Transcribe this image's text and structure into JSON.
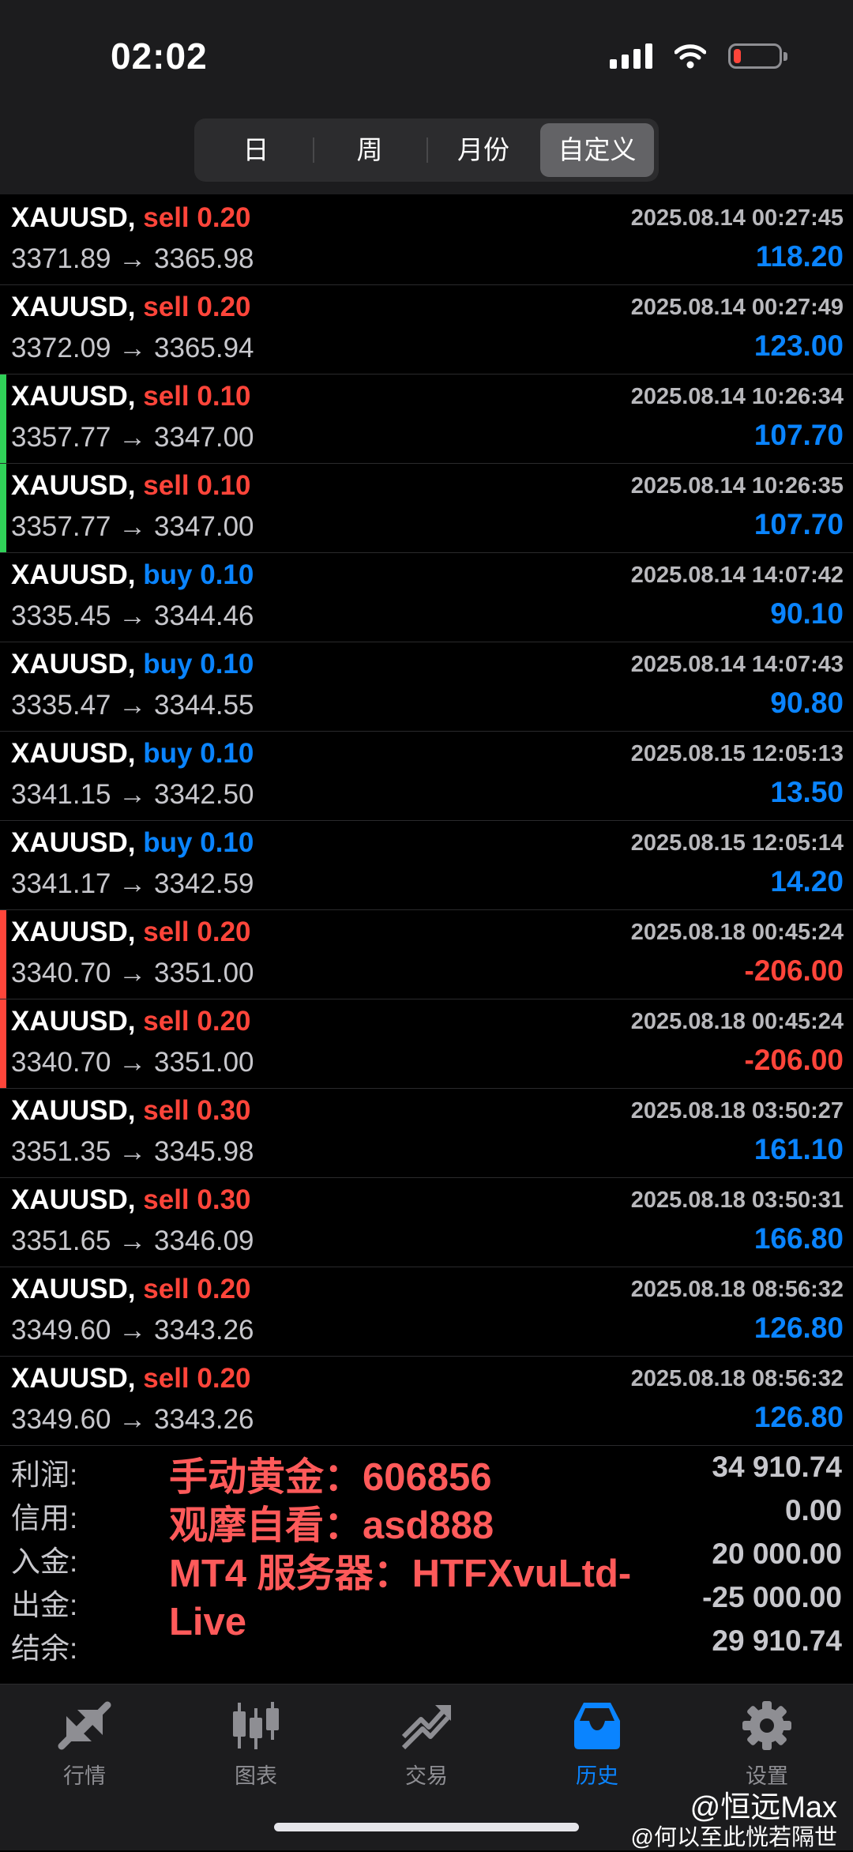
{
  "status_bar": {
    "time": "02:02"
  },
  "period_tabs": [
    {
      "label": "日",
      "active": false
    },
    {
      "label": "周",
      "active": false
    },
    {
      "label": "月份",
      "active": false
    },
    {
      "label": "自定义",
      "active": true
    }
  ],
  "colors": {
    "sell": "#ff453a",
    "buy": "#0a84ff",
    "profit": "#0a84ff",
    "loss": "#ff453a",
    "marker_green": "#30d158",
    "marker_red": "#ff453a"
  },
  "trades": [
    {
      "symbol": "XAUUSD,",
      "side": "sell",
      "lots": "0.20",
      "time": "2025.08.14 00:27:45",
      "open": "3371.89",
      "close": "3365.98",
      "profit": "118.20",
      "marker": ""
    },
    {
      "symbol": "XAUUSD,",
      "side": "sell",
      "lots": "0.20",
      "time": "2025.08.14 00:27:49",
      "open": "3372.09",
      "close": "3365.94",
      "profit": "123.00",
      "marker": ""
    },
    {
      "symbol": "XAUUSD,",
      "side": "sell",
      "lots": "0.10",
      "time": "2025.08.14 10:26:34",
      "open": "3357.77",
      "close": "3347.00",
      "profit": "107.70",
      "marker": "green"
    },
    {
      "symbol": "XAUUSD,",
      "side": "sell",
      "lots": "0.10",
      "time": "2025.08.14 10:26:35",
      "open": "3357.77",
      "close": "3347.00",
      "profit": "107.70",
      "marker": "green"
    },
    {
      "symbol": "XAUUSD,",
      "side": "buy",
      "lots": "0.10",
      "time": "2025.08.14 14:07:42",
      "open": "3335.45",
      "close": "3344.46",
      "profit": "90.10",
      "marker": ""
    },
    {
      "symbol": "XAUUSD,",
      "side": "buy",
      "lots": "0.10",
      "time": "2025.08.14 14:07:43",
      "open": "3335.47",
      "close": "3344.55",
      "profit": "90.80",
      "marker": ""
    },
    {
      "symbol": "XAUUSD,",
      "side": "buy",
      "lots": "0.10",
      "time": "2025.08.15 12:05:13",
      "open": "3341.15",
      "close": "3342.50",
      "profit": "13.50",
      "marker": ""
    },
    {
      "symbol": "XAUUSD,",
      "side": "buy",
      "lots": "0.10",
      "time": "2025.08.15 12:05:14",
      "open": "3341.17",
      "close": "3342.59",
      "profit": "14.20",
      "marker": ""
    },
    {
      "symbol": "XAUUSD,",
      "side": "sell",
      "lots": "0.20",
      "time": "2025.08.18 00:45:24",
      "open": "3340.70",
      "close": "3351.00",
      "profit": "-206.00",
      "marker": "red"
    },
    {
      "symbol": "XAUUSD,",
      "side": "sell",
      "lots": "0.20",
      "time": "2025.08.18 00:45:24",
      "open": "3340.70",
      "close": "3351.00",
      "profit": "-206.00",
      "marker": "red"
    },
    {
      "symbol": "XAUUSD,",
      "side": "sell",
      "lots": "0.30",
      "time": "2025.08.18 03:50:27",
      "open": "3351.35",
      "close": "3345.98",
      "profit": "161.10",
      "marker": ""
    },
    {
      "symbol": "XAUUSD,",
      "side": "sell",
      "lots": "0.30",
      "time": "2025.08.18 03:50:31",
      "open": "3351.65",
      "close": "3346.09",
      "profit": "166.80",
      "marker": ""
    },
    {
      "symbol": "XAUUSD,",
      "side": "sell",
      "lots": "0.20",
      "time": "2025.08.18 08:56:32",
      "open": "3349.60",
      "close": "3343.26",
      "profit": "126.80",
      "marker": ""
    },
    {
      "symbol": "XAUUSD,",
      "side": "sell",
      "lots": "0.20",
      "time": "2025.08.18 08:56:32",
      "open": "3349.60",
      "close": "3343.26",
      "profit": "126.80",
      "marker": ""
    }
  ],
  "summary": [
    {
      "label": "利润:",
      "value": "34 910.74"
    },
    {
      "label": "信用:",
      "value": "0.00"
    },
    {
      "label": "入金:",
      "value": "20 000.00"
    },
    {
      "label": "出金:",
      "value": "-25 000.00"
    },
    {
      "label": "结余:",
      "value": "29 910.74"
    }
  ],
  "overlay_text": [
    "手动黄金：606856",
    "观摩自看：asd888",
    "MT4 服务器：HTFXvuLtd-",
    "Live"
  ],
  "tabbar": [
    {
      "label": "行情",
      "icon": "quotes-arrows-icon",
      "active": false
    },
    {
      "label": "图表",
      "icon": "candlestick-chart-icon",
      "active": false
    },
    {
      "label": "交易",
      "icon": "trade-trend-icon",
      "active": false
    },
    {
      "label": "历史",
      "icon": "history-inbox-icon",
      "active": true
    },
    {
      "label": "设置",
      "icon": "settings-gear-icon",
      "active": false
    }
  ],
  "watermark": {
    "line1": "@恒远Max",
    "line2": "@何以至此恍若隔世"
  }
}
